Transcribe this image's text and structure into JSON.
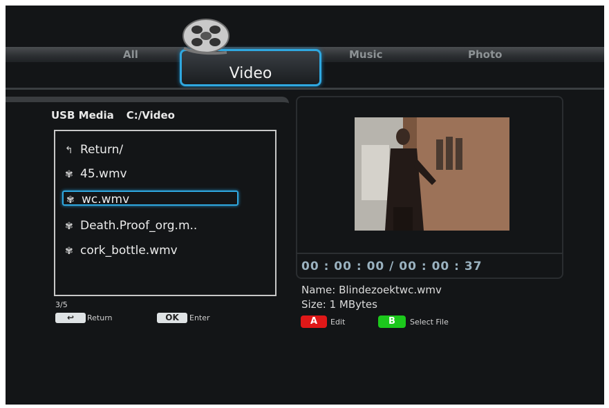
{
  "tabs": {
    "all": "All",
    "video": "Video",
    "music": "Music",
    "photo": "Photo"
  },
  "browser": {
    "device": "USB Media",
    "path": "C:/Video",
    "items": [
      {
        "icon": "return-arrow-icon",
        "label": "Return/"
      },
      {
        "icon": "film-reel-icon",
        "label": "45.wmv"
      },
      {
        "icon": "film-reel-icon",
        "label": "wc.wmv",
        "selected": true
      },
      {
        "icon": "film-reel-icon",
        "label": "Death.Proof_org.m.."
      },
      {
        "icon": "film-reel-icon",
        "label": "cork_bottle.wmv"
      }
    ],
    "page_count": "3/5"
  },
  "hints": {
    "return_key": "↩",
    "return_label": "Return",
    "ok_key": "OK",
    "ok_label": "Enter"
  },
  "preview": {
    "time": "00 : 00 : 00 / 00 : 00 : 37",
    "name": "Name:  Blindezoektwc.wmv",
    "size": "Size:  1   MBytes"
  },
  "keys": {
    "a_key": "A",
    "a_label": "Edit",
    "b_key": "B",
    "b_label": "Select File"
  },
  "colors": {
    "highlight": "#2fa8e0",
    "red_key": "#e01818",
    "green_key": "#1cc81c"
  }
}
